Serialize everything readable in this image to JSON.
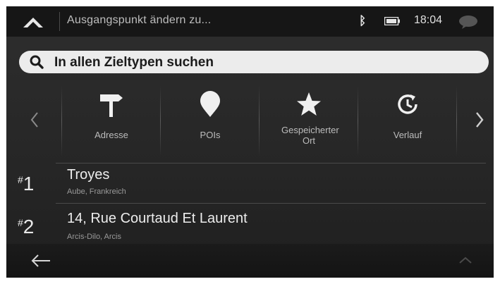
{
  "header": {
    "title": "Ausgangspunkt ändern zu...",
    "clock": "18:04"
  },
  "search": {
    "label": "In allen Zieltypen suchen"
  },
  "destination_types": [
    {
      "label": "Adresse",
      "icon": "signpost-icon"
    },
    {
      "label": "POIs",
      "icon": "location-pin-icon"
    },
    {
      "label": "Gespeicherter Ort",
      "icon": "star-icon"
    },
    {
      "label": "Verlauf",
      "icon": "history-clock-icon"
    }
  ],
  "results": [
    {
      "rank": "1",
      "title": "Troyes",
      "subtitle": "Aube, Frankreich"
    },
    {
      "rank": "2",
      "title": "14, Rue Courtaud Et Laurent",
      "subtitle": "Arcis-Dilo, Arcis"
    }
  ],
  "colors": {
    "background": "#262626",
    "topbar": "#161616",
    "search_bg": "#ececec",
    "text_primary": "#ededed",
    "text_secondary": "#9a9a9a"
  }
}
